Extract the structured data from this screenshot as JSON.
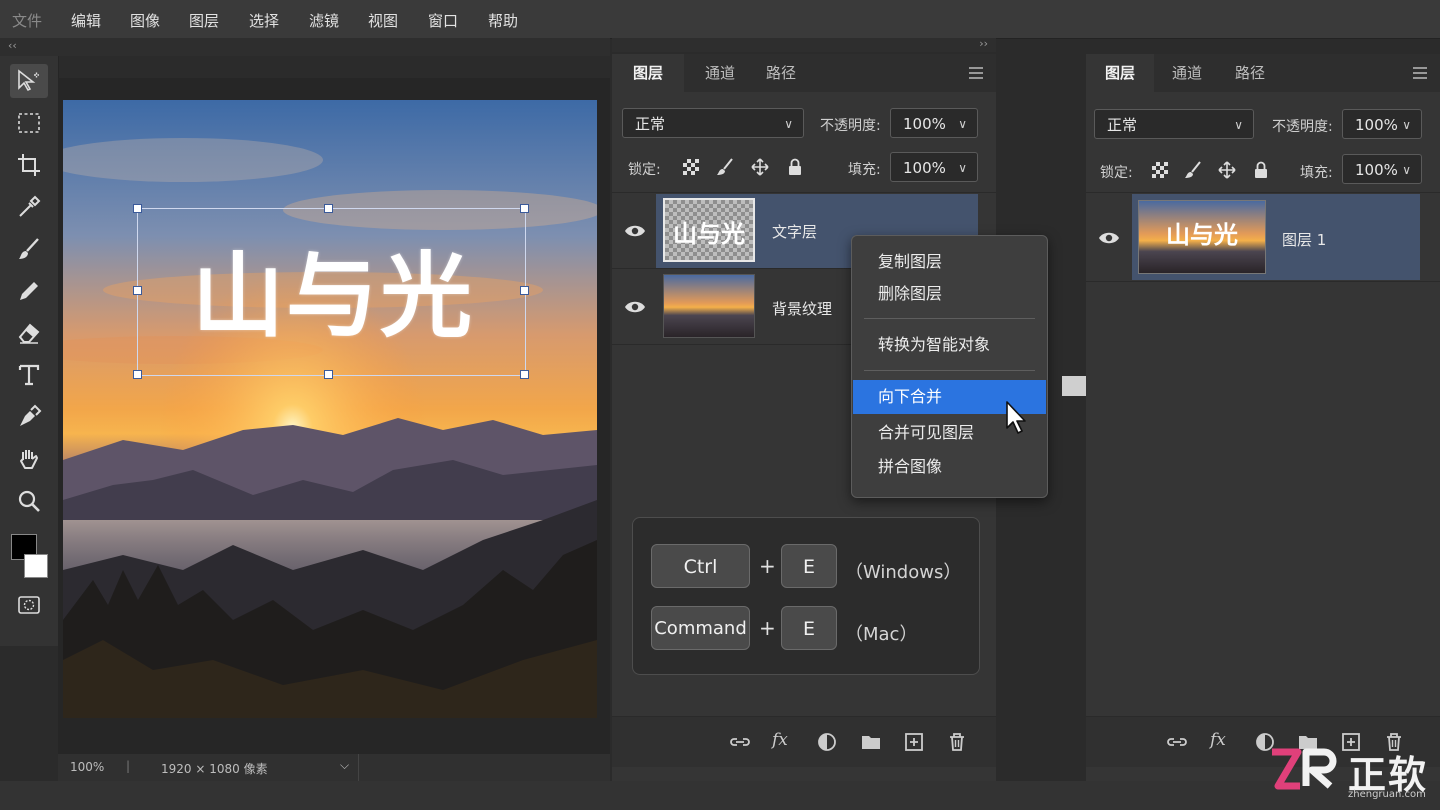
{
  "menubar": {
    "items": [
      "文件",
      "编辑",
      "图像",
      "图层",
      "选择",
      "滤镜",
      "视图",
      "窗口",
      "帮助"
    ]
  },
  "canvas": {
    "artwork_text": "山与光",
    "zoom": "100%",
    "separator": "|",
    "doc_size": "1920 × 1080 像素"
  },
  "left_panel": {
    "tabs": [
      "图层",
      "通道",
      "路径"
    ],
    "blend_mode": "正常",
    "opacity_label": "不透明度:",
    "opacity_value": "100%",
    "lock_label": "锁定:",
    "fill_label": "填充:",
    "fill_value": "100%",
    "layers": [
      {
        "name": "文字层",
        "selected": true
      },
      {
        "name": "背景纹理",
        "selected": false
      }
    ]
  },
  "context_menu": {
    "items": [
      "复制图层",
      "删除图层",
      "转换为智能对象",
      "向下合并",
      "合并可见图层",
      "拼合图像"
    ],
    "highlighted": "向下合并"
  },
  "shortcuts": {
    "windows": {
      "mod": "Ctrl",
      "key": "E",
      "os": "（Windows）"
    },
    "mac": {
      "mod": "Command",
      "key": "E",
      "os": "（Mac）"
    },
    "plus": "+"
  },
  "right_panel": {
    "tabs": [
      "图层",
      "通道",
      "路径"
    ],
    "blend_mode": "正常",
    "opacity_label": "不透明度:",
    "opacity_value": "100%",
    "lock_label": "锁定:",
    "fill_label": "填充:",
    "fill_value": "100%",
    "layers": [
      {
        "name": "图层 1",
        "selected": true
      }
    ]
  },
  "watermark": {
    "brand": "正软",
    "url": "zhengruan.com"
  },
  "colors": {
    "selection": "#2b74e0",
    "layer_selected": "#44536d",
    "watermark_accent": "#e0407a"
  },
  "icons": [
    "move-select-icon",
    "marquee-icon",
    "crop-icon",
    "eyedropper-icon",
    "brush-icon",
    "pencil-icon",
    "eraser-icon",
    "type-icon",
    "pen-icon",
    "hand-icon",
    "zoom-icon",
    "quickmask-icon",
    "eye-icon",
    "link-icon",
    "fx-icon",
    "adjustment-icon",
    "folder-icon",
    "new-layer-icon",
    "trash-icon",
    "menu-icon"
  ]
}
